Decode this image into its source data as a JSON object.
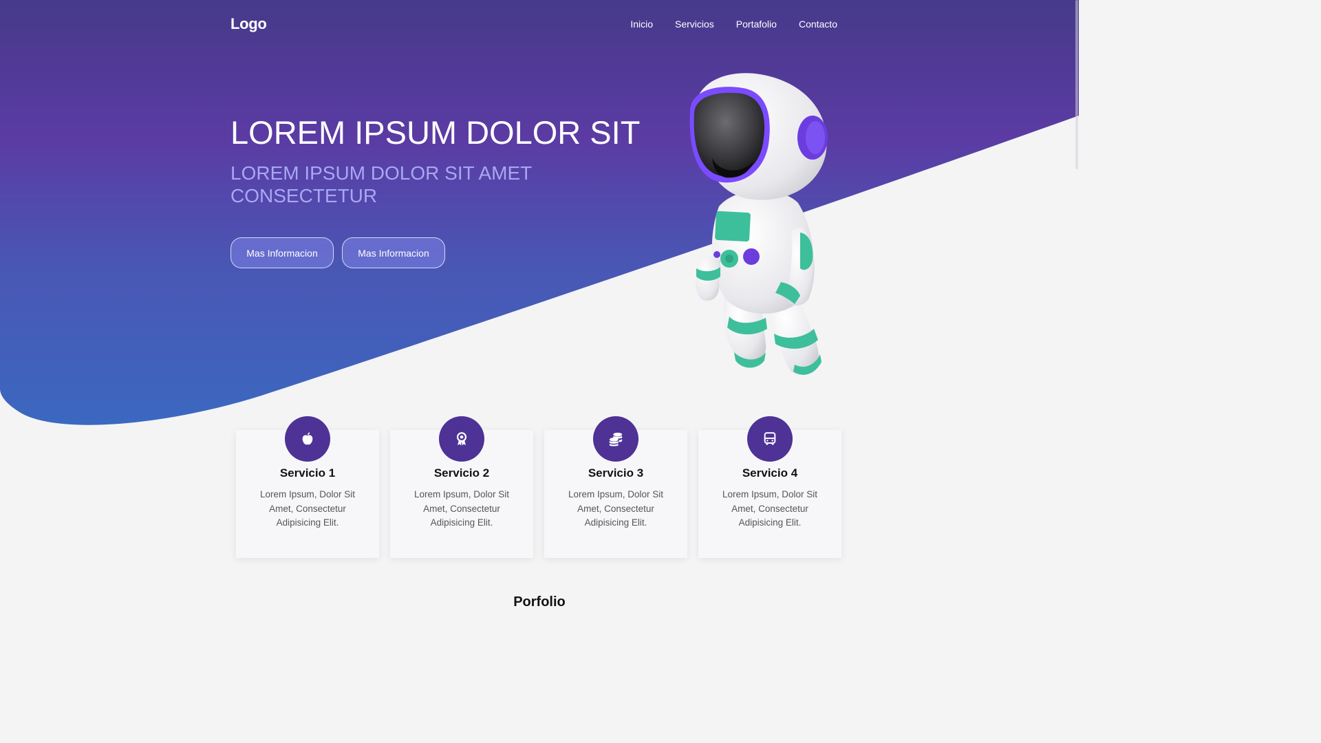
{
  "nav": {
    "logo": "Logo",
    "items": [
      {
        "label": "Inicio"
      },
      {
        "label": "Servicios"
      },
      {
        "label": "Portafolio"
      },
      {
        "label": "Contacto"
      }
    ]
  },
  "hero": {
    "title": "LOREM IPSUM DOLOR SIT",
    "subtitle": "LOREM IPSUM DOLOR SIT AMET CONSECTETUR",
    "buttons": [
      {
        "label": "Mas Informacion"
      },
      {
        "label": "Mas Informacion"
      }
    ],
    "illustration": "astronaut-icon"
  },
  "services": [
    {
      "icon": "apple-icon",
      "title": "Servicio 1",
      "text": "Lorem Ipsum, Dolor Sit Amet, Consectetur Adipisicing Elit."
    },
    {
      "icon": "award-icon",
      "title": "Servicio 2",
      "text": "Lorem Ipsum, Dolor Sit Amet, Consectetur Adipisicing Elit."
    },
    {
      "icon": "coins-icon",
      "title": "Servicio 3",
      "text": "Lorem Ipsum, Dolor Sit Amet, Consectetur Adipisicing Elit."
    },
    {
      "icon": "bus-icon",
      "title": "Servicio 4",
      "text": "Lorem Ipsum, Dolor Sit Amet, Consectetur Adipisicing Elit."
    }
  ],
  "portfolio": {
    "heading": "Porfolio"
  },
  "colors": {
    "hero_top": "#463a8a",
    "hero_mid": "#5b3ba3",
    "hero_bottom": "#3b68c0",
    "accent": "#4e3295",
    "subtitle": "#a9a7f4",
    "background": "#f4f4f5"
  }
}
